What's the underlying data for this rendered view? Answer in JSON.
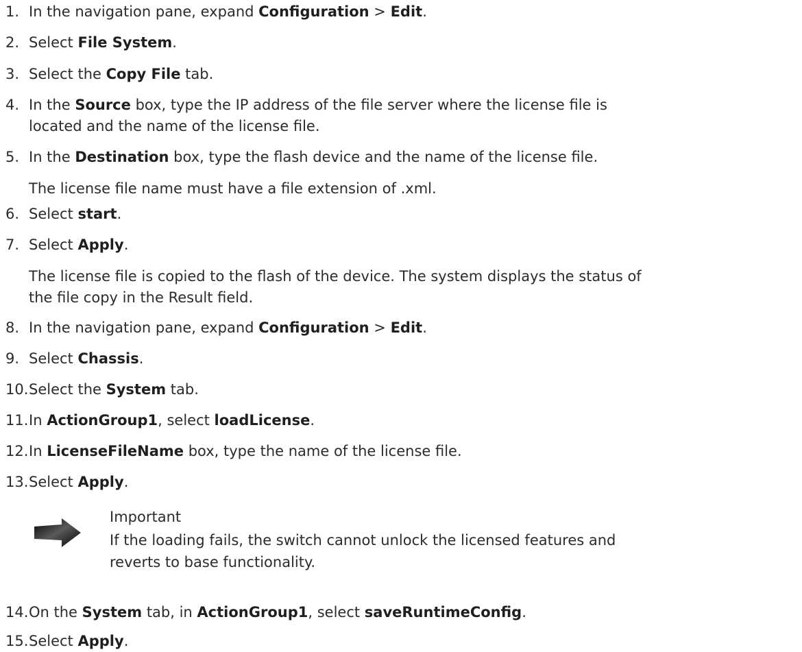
{
  "steps": [
    {
      "num": "1.",
      "parts": [
        "In the navigation pane, expand ",
        "Configuration",
        " > ",
        "Edit",
        "."
      ]
    },
    {
      "num": "2.",
      "parts": [
        "Select ",
        "File System",
        "."
      ]
    },
    {
      "num": "3.",
      "parts": [
        "Select the ",
        "Copy File",
        " tab."
      ]
    },
    {
      "num": "4.",
      "parts": [
        "In the ",
        "Source",
        " box, type the IP address of the file server where the license file is"
      ],
      "cont": "located and the name of the license file."
    },
    {
      "num": "5.",
      "parts": [
        "In the ",
        "Destination",
        " box, type the flash device and the name of the license file."
      ],
      "note": "The license file name must have a file extension of .xml."
    },
    {
      "num": "6.",
      "parts": [
        "Select ",
        "start",
        "."
      ]
    },
    {
      "num": "7.",
      "parts": [
        "Select ",
        "Apply",
        "."
      ],
      "note1": "The license file is copied to the flash of the device. The system displays the status of",
      "note2": "the file copy in the Result field."
    },
    {
      "num": "8.",
      "parts": [
        "In the navigation pane, expand ",
        "Configuration",
        " > ",
        "Edit",
        "."
      ]
    },
    {
      "num": "9.",
      "parts": [
        "Select ",
        "Chassis",
        "."
      ]
    },
    {
      "num": "10.",
      "parts": [
        "Select the ",
        "System",
        " tab."
      ]
    },
    {
      "num": "11.",
      "parts": [
        "In ",
        "ActionGroup1",
        ", select ",
        "loadLicense",
        "."
      ]
    },
    {
      "num": "12.",
      "parts": [
        "In ",
        "LicenseFileName",
        " box, type the name of the license file."
      ]
    },
    {
      "num": "13.",
      "parts": [
        "Select ",
        "Apply",
        "."
      ]
    },
    {
      "num": "14.",
      "parts": [
        "On the ",
        "System",
        " tab, in ",
        "ActionGroup1",
        ", select ",
        "saveRuntimeConfig",
        "."
      ]
    },
    {
      "num": "15.",
      "parts": [
        "Select ",
        "Apply",
        "."
      ]
    }
  ],
  "important": {
    "title": "Important",
    "body_line1": "If the loading fails, the switch cannot unlock the licensed features and",
    "body_line2": "reverts to base functionality.",
    "icon": "arrow-right-icon"
  }
}
